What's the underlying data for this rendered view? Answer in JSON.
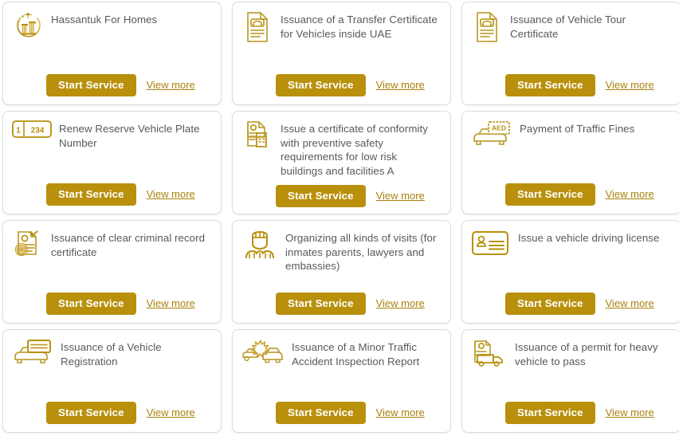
{
  "page": {
    "layout": "service-card-grid",
    "columns": 3,
    "rows": 4,
    "accent_color": "#b8900c",
    "link_color": "#a8820c",
    "title_color": "#58595b",
    "card_border_color": "#dcdcdc",
    "background": "#ffffff"
  },
  "labels": {
    "start_service": "Start Service",
    "view_more": "View more"
  },
  "cards": [
    {
      "title": "Hassantuk For Homes",
      "icon": "hassantuk-logo-icon",
      "start_label": "Start Service",
      "view_label": "View more"
    },
    {
      "title": "Issuance of a Transfer Certificate for Vehicles inside UAE",
      "icon": "vehicle-certificate-document-icon",
      "start_label": "Start Service",
      "view_label": "View more"
    },
    {
      "title": "Issuance of Vehicle Tour Certificate",
      "icon": "vehicle-certificate-document-icon",
      "start_label": "Start Service",
      "view_label": "View more"
    },
    {
      "title": "Renew Reserve Vehicle Plate Number",
      "icon": "license-plate-icon",
      "icon_text_left": "1",
      "icon_text_right": "234",
      "start_label": "Start Service",
      "view_label": "View more"
    },
    {
      "title": "Issue a certificate of conformity with preventive safety requirements for low risk buildings and facilities A",
      "icon": "building-certificate-icon",
      "start_label": "Start Service",
      "view_label": "View more"
    },
    {
      "title": "Payment of Traffic Fines",
      "icon": "traffic-fine-payment-icon",
      "icon_text": "AED",
      "start_label": "Start Service",
      "view_label": "View more"
    },
    {
      "title": "Issuance of clear criminal record certificate",
      "icon": "criminal-record-fingerprint-icon",
      "start_label": "Start Service",
      "view_label": "View more"
    },
    {
      "title": "Organizing all kinds of visits (for inmates parents, lawyers and embassies)",
      "icon": "inmate-visit-icon",
      "start_label": "Start Service",
      "view_label": "View more"
    },
    {
      "title": "Issue a vehicle driving license",
      "icon": "driving-license-card-icon",
      "start_label": "Start Service",
      "view_label": "View more"
    },
    {
      "title": "Issuance of a Vehicle Registration",
      "icon": "vehicle-registration-icon",
      "start_label": "Start Service",
      "view_label": "View more"
    },
    {
      "title": "Issuance of a Minor Traffic Accident Inspection Report",
      "icon": "traffic-accident-icon",
      "start_label": "Start Service",
      "view_label": "View more"
    },
    {
      "title": "Issuance of a permit for heavy vehicle to pass",
      "icon": "heavy-vehicle-permit-icon",
      "start_label": "Start Service",
      "view_label": "View more"
    }
  ]
}
